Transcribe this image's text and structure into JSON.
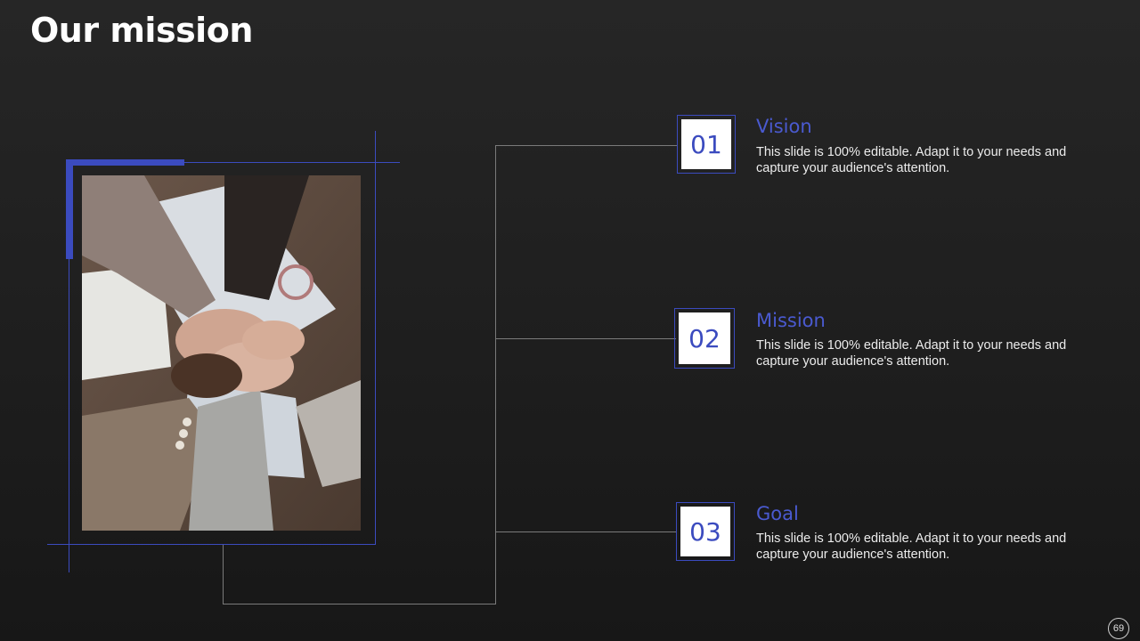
{
  "slide": {
    "title": "Our mission",
    "page_number": "69"
  },
  "items": [
    {
      "number": "01",
      "title": "Vision",
      "description": "This slide is 100% editable. Adapt it to your needs and capture your audience's attention."
    },
    {
      "number": "02",
      "title": "Mission",
      "description": "This slide is 100% editable. Adapt it to your needs and capture your audience's attention."
    },
    {
      "number": "03",
      "title": "Goal",
      "description": "This slide is 100% editable. Adapt it to your needs and capture your audience's attention."
    }
  ],
  "colors": {
    "accent": "#3b4bbf",
    "title_text": "#ffffff",
    "item_title": "#4a5ad0",
    "background": "#1e1e1e"
  },
  "images": {
    "photo": "team-hands-stacked-photo"
  }
}
